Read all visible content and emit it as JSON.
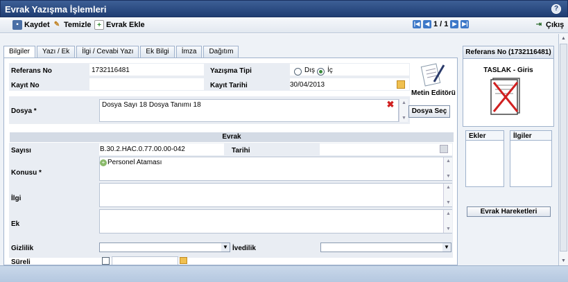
{
  "window": {
    "title": "Evrak Yazışma İşlemleri"
  },
  "toolbar": {
    "save_label": "Kaydet",
    "clear_label": "Temizle",
    "add_doc_label": "Evrak Ekle",
    "pager_text": "1 / 1",
    "exit_label": "Çıkış"
  },
  "tabs": [
    "Bilgiler",
    "Yazı / Ek",
    "İlgi / Cevabi Yazı",
    "Ek Bilgi",
    "İmza",
    "Dağıtım"
  ],
  "form": {
    "ref_label": "Referans No",
    "ref_value": "1732116481",
    "type_label": "Yazışma Tipi",
    "type_dis": "Dış",
    "type_ic": "İç",
    "kayit_no_label": "Kayıt No",
    "kayit_no_value": "",
    "kayit_tarihi_label": "Kayıt Tarihi",
    "kayit_tarihi_value": "30/04/2013",
    "editor_label": "Metin Editörü",
    "dosya_label": "Dosya *",
    "dosya_value": "Dosya Sayı 18 Dosya Tanımı 18",
    "dosya_sec": "Dosya Seç",
    "evrak_header": "Evrak",
    "sayisi_label": "Sayısı",
    "sayisi_value": "B.30.2.HAC.0.77.00.00-042",
    "tarihi_label": "Tarihi",
    "tarihi_value": "",
    "konusu_label": "Konusu *",
    "konusu_value": "Personel Ataması",
    "ilgi_label": "İlgi",
    "ilgi_value": "",
    "ek_label": "Ek",
    "ek_value": "",
    "gizlilik_label": "Gizlilik",
    "gizlilik_value": "",
    "ivedilik_label": "İvedilik",
    "ivedilik_value": "",
    "sureli_label": "Süreli",
    "sureli_value": ""
  },
  "right": {
    "ref_title": "Referans No (1732116481)",
    "status": "TASLAK - Giris",
    "ekler": "Ekler",
    "ilgiler": "İlgiler",
    "hareketler": "Evrak Hareketleri"
  },
  "colors": {
    "title_bar": "#1f3d72",
    "accent": "#3d78c8"
  }
}
